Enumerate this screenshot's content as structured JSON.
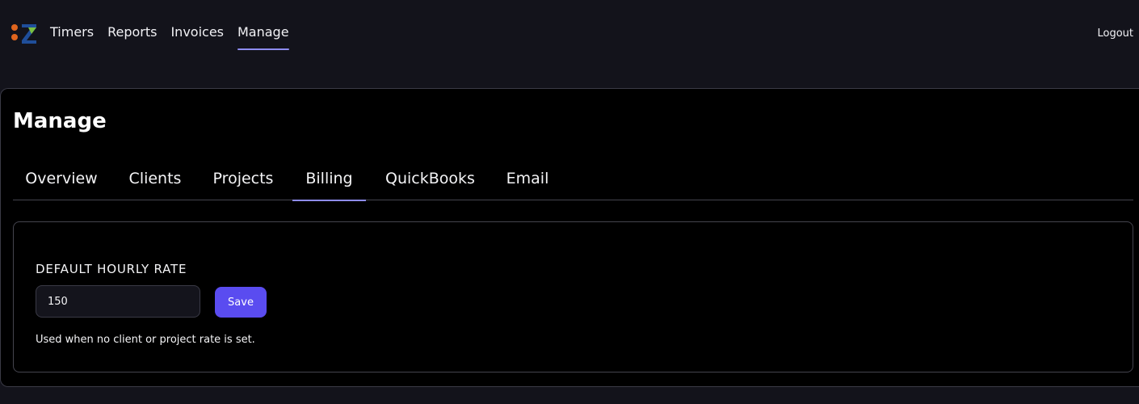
{
  "header": {
    "logo_icon": "app-logo",
    "nav": [
      {
        "label": "Timers",
        "active": false
      },
      {
        "label": "Reports",
        "active": false
      },
      {
        "label": "Invoices",
        "active": false
      },
      {
        "label": "Manage",
        "active": true
      }
    ],
    "logout_label": "Logout"
  },
  "page": {
    "title": "Manage",
    "tabs": [
      {
        "label": "Overview",
        "active": false
      },
      {
        "label": "Clients",
        "active": false
      },
      {
        "label": "Projects",
        "active": false
      },
      {
        "label": "Billing",
        "active": true
      },
      {
        "label": "QuickBooks",
        "active": false
      },
      {
        "label": "Email",
        "active": false
      }
    ]
  },
  "billing": {
    "rate_label": "DEFAULT HOURLY RATE",
    "rate_value": "150",
    "save_label": "Save",
    "help_text": "Used when no client or project rate is set."
  },
  "colors": {
    "accent": "#8e8cf0",
    "button": "#5a4cf0",
    "logo_orange": "#e0651e",
    "logo_green": "#7ac142",
    "logo_blue": "#1f4e9a"
  }
}
